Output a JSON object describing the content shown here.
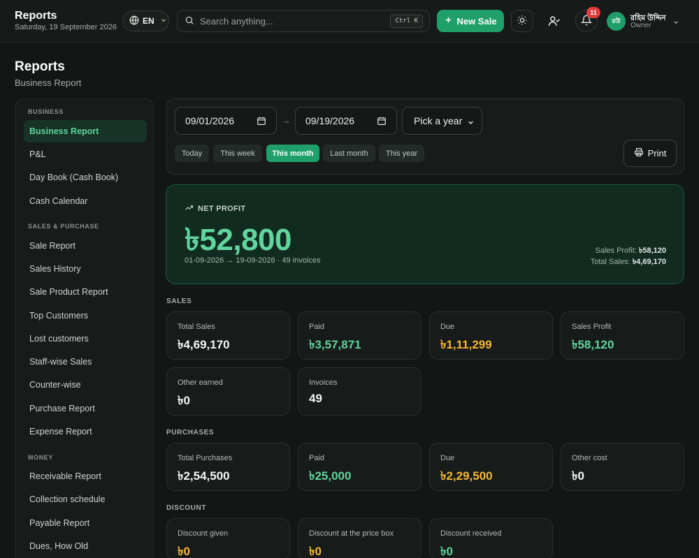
{
  "app": {
    "title": "Reports",
    "date": "Saturday, 19 September 2026"
  },
  "topbar": {
    "lang": "EN",
    "search_placeholder": "Search anything...",
    "search_shortcut": "Ctrl K",
    "new_sale": "New Sale",
    "notifications_count": "11",
    "avatar_initials": "রউ",
    "user_name": "রহিম উদ্দিন",
    "user_role": "Owner"
  },
  "page": {
    "title": "Reports",
    "subtitle": "Business Report"
  },
  "sidebar": {
    "sections": [
      {
        "title": "BUSINESS",
        "items": [
          "Business Report",
          "P&L",
          "Day Book (Cash Book)",
          "Cash Calendar"
        ]
      },
      {
        "title": "SALES & PURCHASE",
        "items": [
          "Sale Report",
          "Sales History",
          "Sale Product Report",
          "Top Customers",
          "Lost customers",
          "Staff-wise Sales",
          "Counter-wise",
          "Purchase Report",
          "Expense Report"
        ]
      },
      {
        "title": "MONEY",
        "items": [
          "Receivable Report",
          "Collection schedule",
          "Payable Report",
          "Dues, How Old"
        ]
      }
    ],
    "active_item": "Business Report"
  },
  "filters": {
    "from_date": "09/01/2026",
    "to_date": "09/19/2026",
    "year_select": "Pick a year",
    "quick": [
      "Today",
      "This week",
      "This month",
      "Last month",
      "This year"
    ],
    "active_quick": "This month",
    "print": "Print"
  },
  "net_profit": {
    "label": "NET PROFIT",
    "value": "৳52,800",
    "range": "01-09-2026 → 19-09-2026 · 49 invoices",
    "sales_profit_label": "Sales Profit:",
    "sales_profit_value": "৳58,120",
    "total_sales_label": "Total Sales:",
    "total_sales_value": "৳4,69,170"
  },
  "sales": {
    "title": "SALES",
    "stats": [
      {
        "label": "Total Sales",
        "value": "৳4,69,170",
        "tone": "white"
      },
      {
        "label": "Paid",
        "value": "৳3,57,871",
        "tone": "green"
      },
      {
        "label": "Due",
        "value": "৳1,11,299",
        "tone": "amber"
      },
      {
        "label": "Sales Profit",
        "value": "৳58,120",
        "tone": "green"
      },
      {
        "label": "Other earned",
        "value": "৳0",
        "tone": "white"
      },
      {
        "label": "Invoices",
        "value": "49",
        "tone": "white"
      }
    ]
  },
  "purchases": {
    "title": "PURCHASES",
    "stats": [
      {
        "label": "Total Purchases",
        "value": "৳2,54,500",
        "tone": "white"
      },
      {
        "label": "Paid",
        "value": "৳25,000",
        "tone": "green"
      },
      {
        "label": "Due",
        "value": "৳2,29,500",
        "tone": "amber"
      },
      {
        "label": "Other cost",
        "value": "৳0",
        "tone": "white"
      }
    ]
  },
  "discount": {
    "title": "DISCOUNT",
    "stats": [
      {
        "label": "Discount given",
        "value": "৳0",
        "tone": "amber"
      },
      {
        "label": "Discount at the price box",
        "value": "৳0",
        "tone": "amber"
      },
      {
        "label": "Discount received",
        "value": "৳0",
        "tone": "green"
      }
    ]
  },
  "colors": {
    "accent": "#1fa06a",
    "green_text": "#5fd49c",
    "amber_text": "#f5b833",
    "badge": "#e23b3b"
  }
}
